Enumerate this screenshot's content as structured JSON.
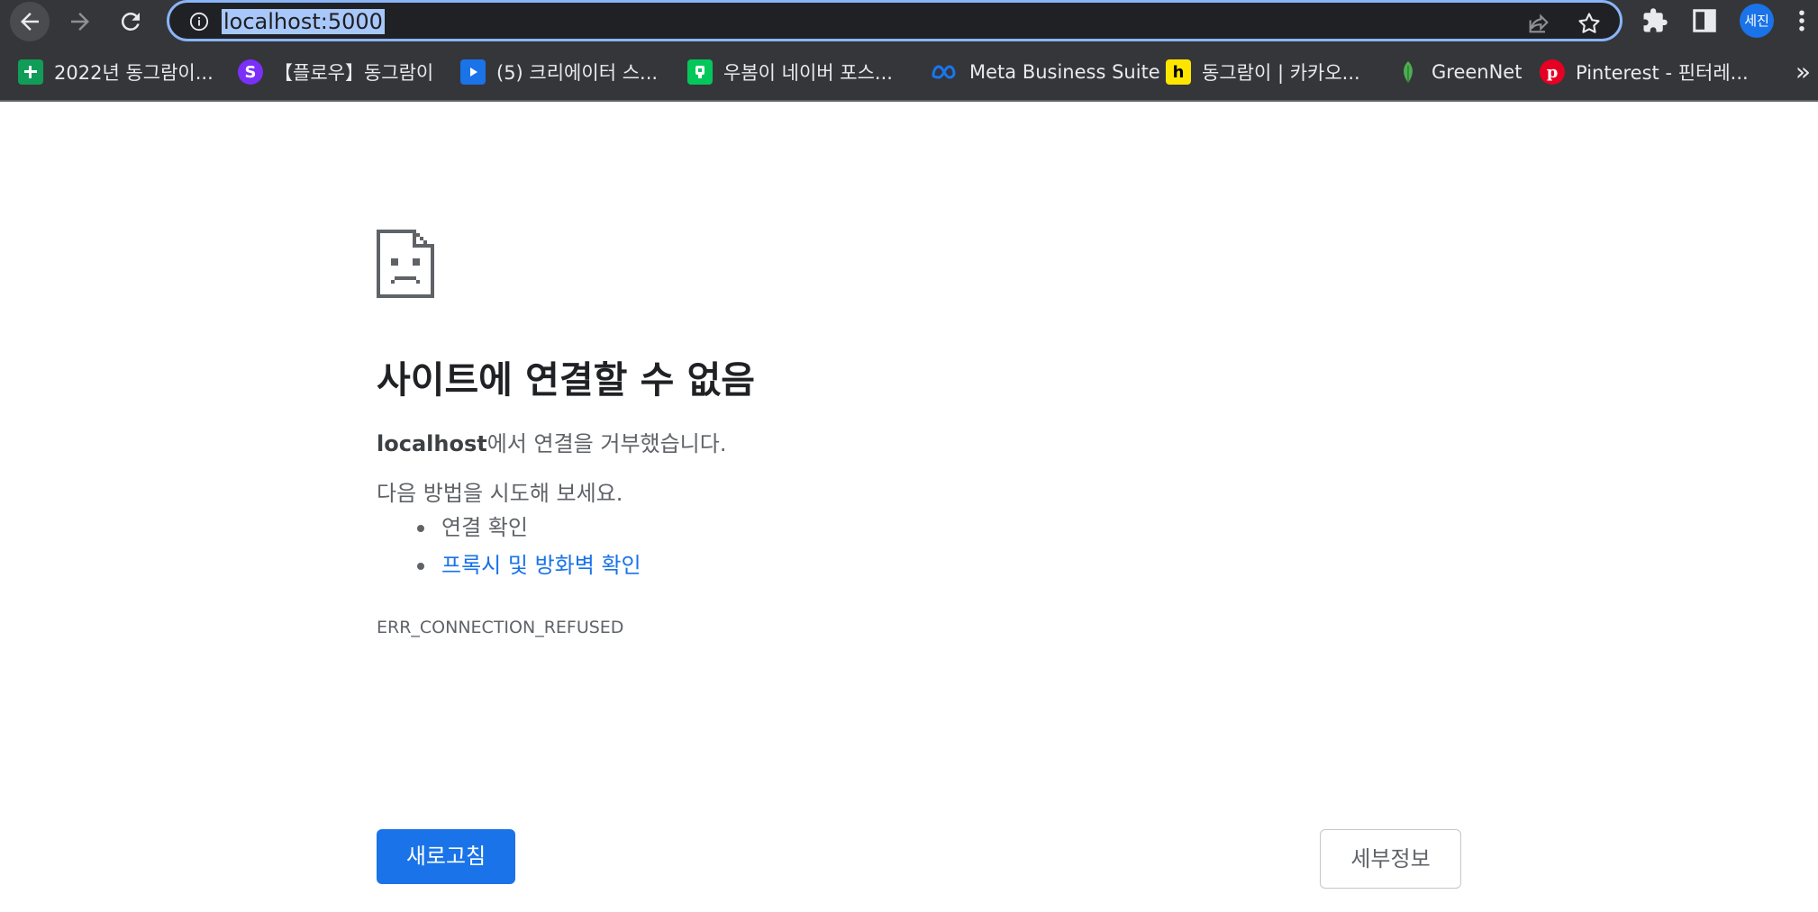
{
  "browser": {
    "url": "localhost:5000",
    "avatar_label": "세진",
    "bookmarks": [
      {
        "label": "2022년 동그람이...",
        "icon": "google-sheets-icon",
        "color": "#0f9d58"
      },
      {
        "label": "【플로우】동그람이",
        "icon": "flow-icon",
        "color": "#7b2ff7"
      },
      {
        "label": "(5) 크리에이터 스...",
        "icon": "creator-studio-icon",
        "color": "#1a73e8"
      },
      {
        "label": "우봄이 네이버 포스...",
        "icon": "naver-post-icon",
        "color": "#03c75a"
      },
      {
        "label": "Meta Business Suite",
        "icon": "meta-icon",
        "color": "#0668e1"
      },
      {
        "label": "동그람이 | 카카오...",
        "icon": "kakao-h-icon",
        "color": "#fee500"
      },
      {
        "label": "GreenNet",
        "icon": "greennet-leaf-icon",
        "color": "#4caf50"
      },
      {
        "label": "Pinterest - 핀터레...",
        "icon": "pinterest-icon",
        "color": "#e60023"
      }
    ],
    "more_bookmarks": "»"
  },
  "page": {
    "title": "사이트에 연결할 수 없음",
    "desc_host": "localhost",
    "desc_rest": "에서 연결을 거부했습니다.",
    "suggest_title": "다음 방법을 시도해 보세요.",
    "suggestions": [
      "연결 확인",
      "프록시 및 방화벽 확인"
    ],
    "error_code": "ERR_CONNECTION_REFUSED",
    "reload_label": "새로고침",
    "details_label": "세부정보"
  }
}
